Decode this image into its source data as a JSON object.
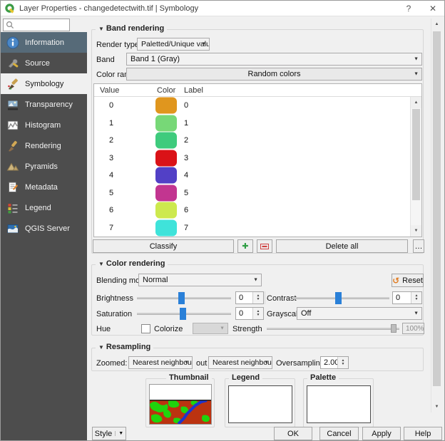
{
  "window": {
    "title": "Layer Properties - changedetectwith.tif | Symbology",
    "help_glyph": "?",
    "close_glyph": "✕"
  },
  "icons": {
    "dropdown_arrow": "▼",
    "spin_up": "▲",
    "spin_down": "▼",
    "scroll_up": "▲",
    "scroll_down": "▼",
    "collapse_triangle": "▼",
    "reset_arrow": "↺",
    "plus": "✚",
    "minus": "▬",
    "more": "…"
  },
  "sidebar": {
    "items": [
      {
        "label": "Information"
      },
      {
        "label": "Source"
      },
      {
        "label": "Symbology"
      },
      {
        "label": "Transparency"
      },
      {
        "label": "Histogram"
      },
      {
        "label": "Rendering"
      },
      {
        "label": "Pyramids"
      },
      {
        "label": "Metadata"
      },
      {
        "label": "Legend"
      },
      {
        "label": "QGIS Server"
      }
    ],
    "selected": "Symbology"
  },
  "band_rendering": {
    "title": "Band rendering",
    "render_type_label": "Render type",
    "render_type_value": "Paletted/Unique values",
    "band_label": "Band",
    "band_value": "Band 1 (Gray)",
    "color_ramp_label": "Color ramp",
    "color_ramp_value": "Random colors",
    "table": {
      "headers": [
        "Value",
        "Color",
        "Label"
      ],
      "rows": [
        {
          "value": "0",
          "color": "#e0961e",
          "label": "0"
        },
        {
          "value": "1",
          "color": "#77d877",
          "label": "1"
        },
        {
          "value": "2",
          "color": "#3fcb7d",
          "label": "2"
        },
        {
          "value": "3",
          "color": "#da1217",
          "label": "3"
        },
        {
          "value": "4",
          "color": "#5240c6",
          "label": "4"
        },
        {
          "value": "5",
          "color": "#c23590",
          "label": "5"
        },
        {
          "value": "6",
          "color": "#cde94e",
          "label": "6"
        },
        {
          "value": "7",
          "color": "#3fe3da",
          "label": "7"
        }
      ]
    },
    "classify_label": "Classify",
    "delete_all_label": "Delete all"
  },
  "color_rendering": {
    "title": "Color rendering",
    "blending_mode_label": "Blending mode",
    "blending_mode_value": "Normal",
    "reset_label": "Reset",
    "brightness_label": "Brightness",
    "brightness_value": "0",
    "contrast_label": "Contrast",
    "contrast_value": "0",
    "saturation_label": "Saturation",
    "saturation_value": "0",
    "grayscale_label": "Grayscale",
    "grayscale_value": "Off",
    "hue_label": "Hue",
    "colorize_label": "Colorize",
    "strength_label": "Strength",
    "strength_value": "100%"
  },
  "resampling": {
    "title": "Resampling",
    "zoomed_in_label": "Zoomed: in",
    "zoomed_in_value": "Nearest neighbour",
    "out_label": "out",
    "out_value": "Nearest neighbour",
    "oversampling_label": "Oversampling",
    "oversampling_value": "2.00"
  },
  "preview": {
    "thumbnail_title": "Thumbnail",
    "legend_title": "Legend",
    "palette_title": "Palette"
  },
  "footer": {
    "style_label": "Style",
    "ok_label": "OK",
    "cancel_label": "Cancel",
    "apply_label": "Apply",
    "help_label": "Help"
  },
  "colors": {
    "slider_thumb": "#2a80d8",
    "sidebar_bg": "#4d4d4d",
    "sidebar_highlight": "#566a78",
    "selected_item_bg": "#f0f0f0",
    "thumbnail_ground": "#bb3310",
    "thumbnail_vegetation": "#1fd40c",
    "thumbnail_river": "#1d35cf"
  }
}
